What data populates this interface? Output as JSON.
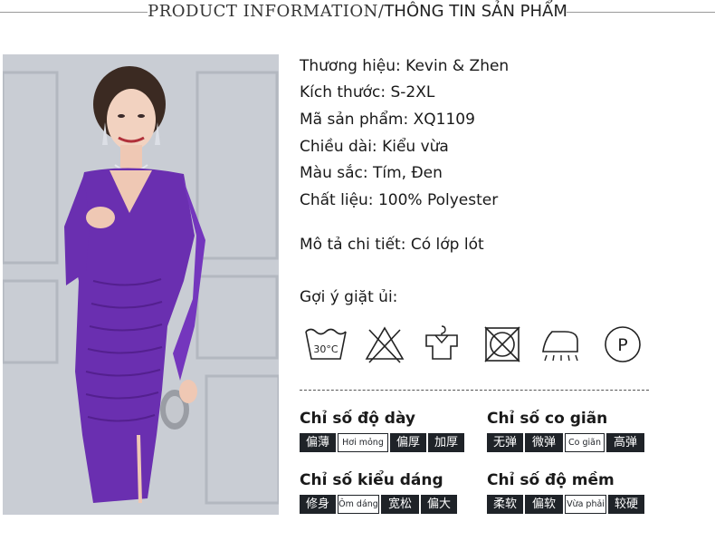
{
  "header": {
    "title_en": "PRODUCT INFORMATION/",
    "title_vn": "THÔNG TIN SẢN PHẨM"
  },
  "product_info": [
    "Thương hiệu: Kevin & Zhen",
    "Kích thước: S-2XL",
    "Mã sản phẩm: XQ1109",
    "Chiều dài: Kiểu vừa",
    "Màu sắc: Tím, Đen",
    "Chất liệu: 100% Polyester"
  ],
  "description": "Mô tả chi tiết: Có lớp lót",
  "care": {
    "title": "Gợi ý giặt ủi:",
    "temp_label": "30°C",
    "dryclean_label": "P",
    "icons": [
      "wash-30c-icon",
      "no-bleach-icon",
      "hang-dry-icon",
      "no-tumble-dry-icon",
      "iron-steam-icon",
      "dry-clean-p-icon"
    ]
  },
  "indices": {
    "thickness": {
      "title": "Chỉ số độ dày",
      "options": [
        "偏薄",
        "Hơi mỏng",
        "偏厚",
        "加厚"
      ],
      "selected": 1
    },
    "stretch": {
      "title": "Chỉ số co giãn",
      "options": [
        "无弹",
        "微弹",
        "Co giãn",
        "高弹"
      ],
      "selected": 2
    },
    "fit": {
      "title": "Chỉ số kiểu dáng",
      "options": [
        "修身",
        "Ôm dáng",
        "宽松",
        "偏大"
      ],
      "selected": 1
    },
    "softness": {
      "title": "Chỉ số độ mềm",
      "options": [
        "柔软",
        "偏软",
        "Vừa phải",
        "较硬"
      ],
      "selected": 2
    }
  },
  "colors": {
    "chip_dark": "#1f2328",
    "dress_purple": "#6a2fb0",
    "background": "#ffffff"
  }
}
